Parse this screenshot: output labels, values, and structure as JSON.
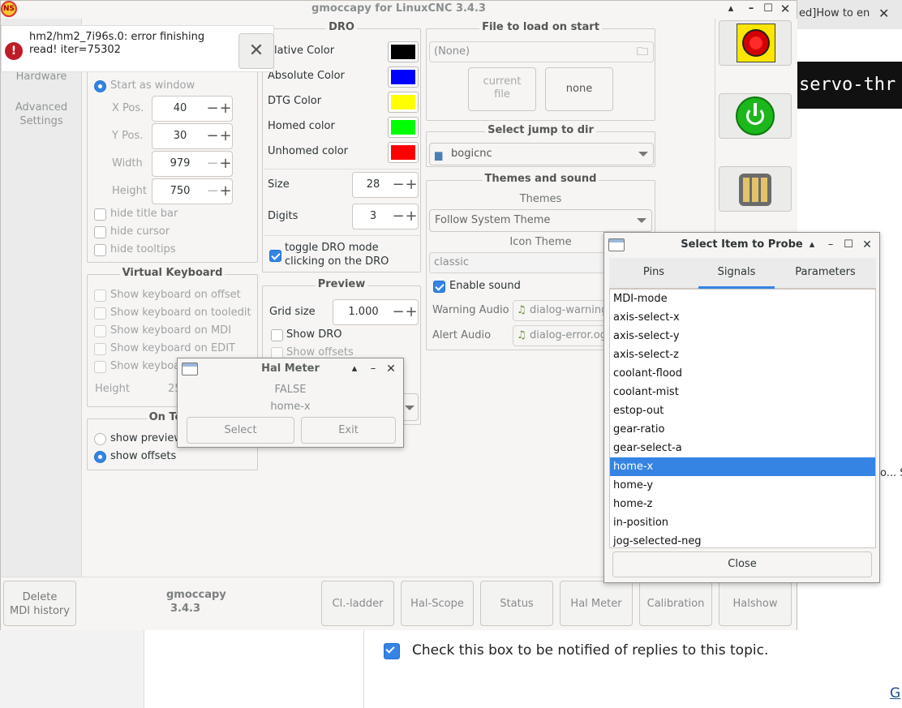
{
  "window": {
    "title": "gmoccapy for LinuxCNC  3.4.3"
  },
  "background": {
    "tab_text": "ed]How to en",
    "code_text": "servo-thr",
    "side_text": "o... S",
    "notify_label": "Check this box to be notified of replies to this topic.",
    "link_text": "G"
  },
  "error": {
    "message_line1": "hm2/hm2_7i96s.0: error finishing",
    "message_line2": "read! iter=75302"
  },
  "sidebar": {
    "items": [
      "Hardware",
      "Advanced",
      "Settings"
    ]
  },
  "window_settings": {
    "start_as_window": "Start as window",
    "x_label": "X Pos.",
    "x_value": "40",
    "y_label": "Y Pos.",
    "y_value": "30",
    "width_label": "Width",
    "width_value": "979",
    "height_label": "Height",
    "height_value": "750",
    "hide_title_bar": "hide title bar",
    "hide_cursor": "hide cursor",
    "hide_tooltips": "hide tooltips"
  },
  "virtual_keyboard": {
    "title": "Virtual Keyboard",
    "items": [
      "Show keyboard on offset",
      "Show keyboard on tooledit",
      "Show keyboard on MDI",
      "Show keyboard on EDIT",
      "Show keyboa"
    ],
    "height_label": "Height",
    "height_value": "25"
  },
  "on_touch": {
    "title": "On Touc",
    "show_preview": "show preview",
    "show_offsets": "show offsets"
  },
  "dro": {
    "title": "DRO",
    "colors": [
      {
        "label": "elative Color",
        "color": "#000000"
      },
      {
        "label": "Absolute Color",
        "color": "#0000ff"
      },
      {
        "label": "DTG Color",
        "color": "#ffff00"
      },
      {
        "label": "Homed color",
        "color": "#00ff00"
      },
      {
        "label": "Unhomed color",
        "color": "#ff0000"
      }
    ],
    "size_label": "Size",
    "size_value": "28",
    "digits_label": "Digits",
    "digits_value": "3",
    "toggle_label_1": "toggle DRO mode",
    "toggle_label_2": "clicking on the DRO"
  },
  "preview": {
    "title": "Preview",
    "grid_label": "Grid size",
    "grid_value": "1.000",
    "show_dro": "Show DRO",
    "show_offsets": "Show offsets"
  },
  "file_load": {
    "title": "File to load on start",
    "value": "(None)",
    "current_file_1": "current",
    "current_file_2": "file",
    "none_button": "none"
  },
  "jump_dir": {
    "title": "Select jump to dir",
    "value": "bogicnc"
  },
  "themes": {
    "title": "Themes and sound",
    "themes_label": "Themes",
    "theme_value": "Follow System Theme",
    "icon_theme_label": "Icon Theme",
    "icon_theme_value": "classic",
    "enable_sound": "Enable sound",
    "warning_label": "Warning Audio",
    "warning_value": "dialog-warning",
    "alert_label": "Alert Audio",
    "alert_value": "dialog-error.og"
  },
  "bottom": {
    "delete_mdi_1": "Delete",
    "delete_mdi_2": "MDI history",
    "app_name": "gmoccapy",
    "app_version": "3.4.3",
    "buttons": [
      "Cl.-ladder",
      "Hal-Scope",
      "Status",
      "Hal Meter",
      "Calibration",
      "Halshow"
    ]
  },
  "hal_meter": {
    "title": "Hal Meter",
    "value": "FALSE",
    "signal": "home-x",
    "select": "Select",
    "exit": "Exit"
  },
  "probe": {
    "title": "Select Item to Probe",
    "tabs": [
      "Pins",
      "Signals",
      "Parameters"
    ],
    "items": [
      "MDI-mode",
      "axis-select-x",
      "axis-select-y",
      "axis-select-z",
      "coolant-flood",
      "coolant-mist",
      "estop-out",
      "gear-ratio",
      "gear-select-a",
      "home-x",
      "home-y",
      "home-z",
      "in-position",
      "jog-selected-neg"
    ],
    "selected_index": 9,
    "close": "Close"
  }
}
